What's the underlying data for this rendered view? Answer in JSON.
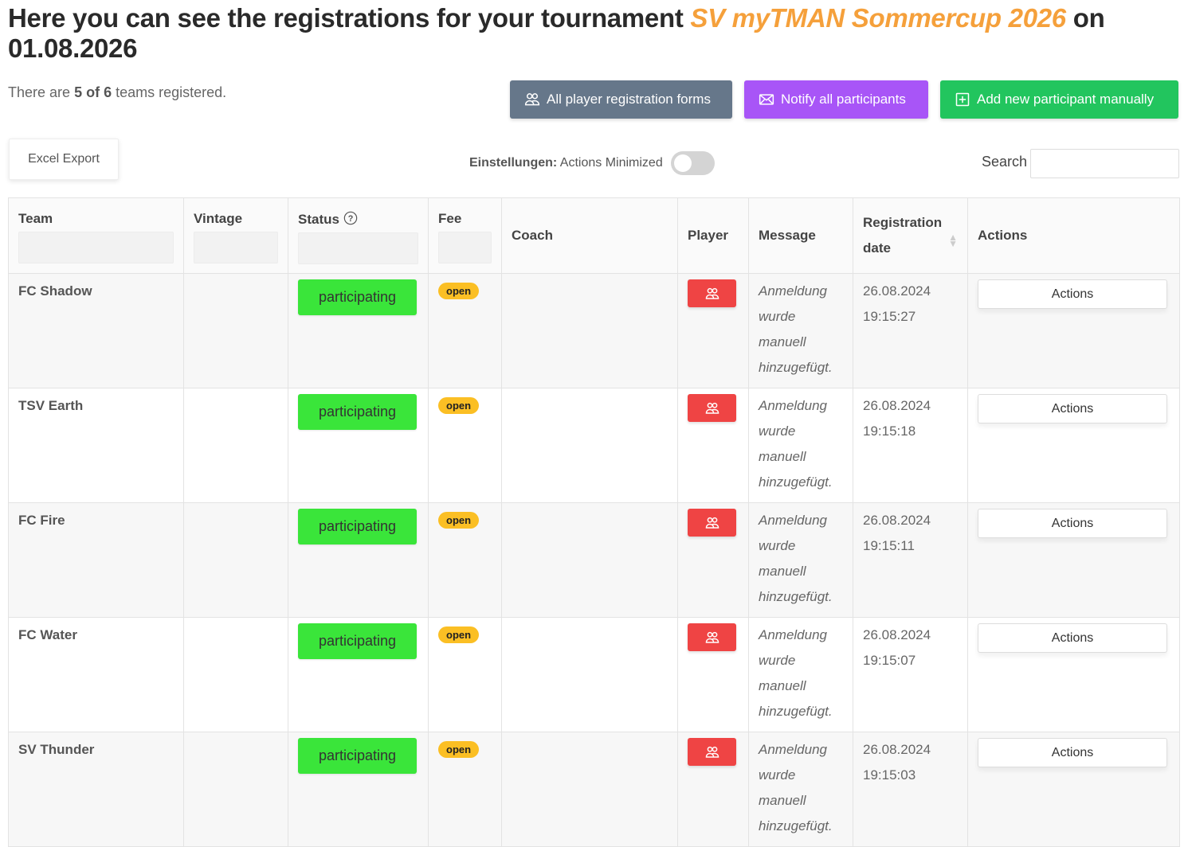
{
  "header": {
    "title_prefix": "Here you can see the registrations for your tournament",
    "tournament_name": "SV myTMAN Sommercup 2026",
    "title_on": "on",
    "tournament_date": "01.08.2026",
    "accent_color": "#f5a03b"
  },
  "summary": {
    "prefix": "There are",
    "count": "5 of 6",
    "suffix": "teams registered."
  },
  "toolbar": {
    "forms_label": "All player registration forms",
    "notify_label": "Notify all participants",
    "add_label": "Add new participant manually",
    "excel_label": "Excel Export",
    "settings_label": "Einstellungen:",
    "settings_value": "Actions Minimized",
    "toggle_on": false,
    "search_label": "Search",
    "search_value": ""
  },
  "colors": {
    "forms_button": "#66778a",
    "notify_button": "#a855f7",
    "add_button": "#22c55e",
    "status_participating": "#3ae53a",
    "fee_open": "#fbbf24",
    "player_button": "#ef4444"
  },
  "table": {
    "columns": [
      "Team",
      "Vintage",
      "Status",
      "Fee",
      "Coach",
      "Player",
      "Message",
      "Registration date",
      "Actions"
    ],
    "rows": [
      {
        "team": "FC Shadow",
        "vintage": "",
        "status": "participating",
        "fee": "open",
        "coach": "",
        "message": "Anmeldung wurde manuell hinzugefügt.",
        "date": "26.08.2024",
        "time": "19:15:27",
        "action_label": "Actions"
      },
      {
        "team": "TSV Earth",
        "vintage": "",
        "status": "participating",
        "fee": "open",
        "coach": "",
        "message": "Anmeldung wurde manuell hinzugefügt.",
        "date": "26.08.2024",
        "time": "19:15:18",
        "action_label": "Actions"
      },
      {
        "team": "FC Fire",
        "vintage": "",
        "status": "participating",
        "fee": "open",
        "coach": "",
        "message": "Anmeldung wurde manuell hinzugefügt.",
        "date": "26.08.2024",
        "time": "19:15:11",
        "action_label": "Actions"
      },
      {
        "team": "FC Water",
        "vintage": "",
        "status": "participating",
        "fee": "open",
        "coach": "",
        "message": "Anmeldung wurde manuell hinzugefügt.",
        "date": "26.08.2024",
        "time": "19:15:07",
        "action_label": "Actions"
      },
      {
        "team": "SV Thunder",
        "vintage": "",
        "status": "participating",
        "fee": "open",
        "coach": "",
        "message": "Anmeldung wurde manuell hinzugefügt.",
        "date": "26.08.2024",
        "time": "19:15:03",
        "action_label": "Actions"
      }
    ]
  }
}
